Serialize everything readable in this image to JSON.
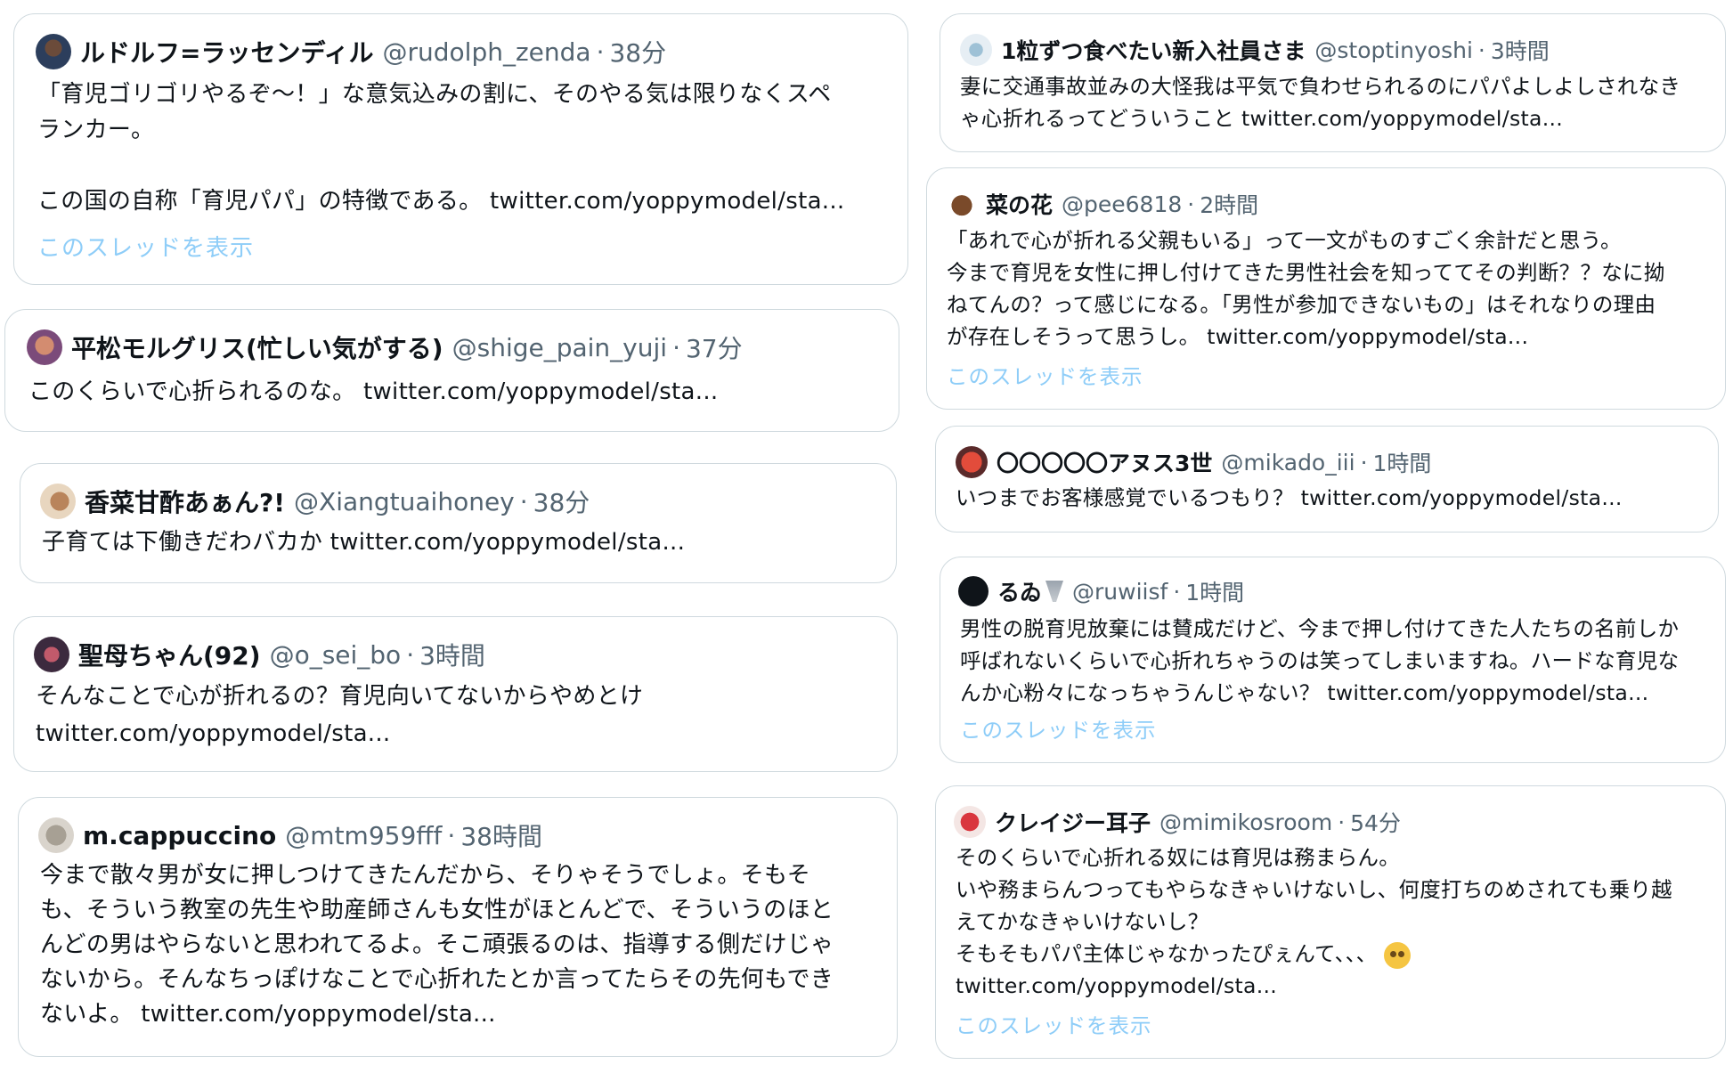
{
  "tweets": [
    {
      "name": "ルドルフ=ラッセンディル",
      "handle": "@rudolph_zenda",
      "time": "38分",
      "lines": [
        "「育児ゴリゴリやるぞ〜！」な意気込みの割に、そのやる気は限りなくスペ",
        "ランカー。",
        "",
        "この国の自称「育児パパ」の特徴である。 twitter.com/yoppymodel/sta..."
      ],
      "thread": "このスレッドを表示"
    },
    {
      "name": "平松モルグリス(忙しい気がする)",
      "handle": "@shige_pain_yuji",
      "time": "37分",
      "lines": [
        "このくらいで心折られるのな。 twitter.com/yoppymodel/sta..."
      ]
    },
    {
      "name": "香菜甘酢あぁん?!",
      "handle": "@Xiangtuaihoney",
      "time": "38分",
      "lines": [
        "子育ては下働きだわバカか twitter.com/yoppymodel/sta..."
      ]
    },
    {
      "name": "聖母ちゃん(92)",
      "handle": "@o_sei_bo",
      "time": "3時間",
      "lines": [
        "そんなことで心が折れるの？育児向いてないからやめとけ",
        "twitter.com/yoppymodel/sta..."
      ]
    },
    {
      "name": "m.cappuccino",
      "handle": "@mtm959fff",
      "time": "38時間",
      "lines": [
        "今まで散々男が女に押しつけてきたんだから、そりゃそうでしょ。そもそ",
        "も、そういう教室の先生や助産師さんも女性がほとんどで、そういうのほと",
        "んどの男はやらないと思われてるよ。そこ頑張るのは、指導する側だけじゃ",
        "ないから。そんなちっぽけなことで心折れたとか言ってたらその先何もでき",
        "ないよ。 twitter.com/yoppymodel/sta..."
      ]
    },
    {
      "name": "1粒ずつ食べたい新入社員さま",
      "handle": "@stoptinyoshi",
      "time": "3時間",
      "lines": [
        "妻に交通事故並みの大怪我は平気で負わせられるのにパパよしよしされなき",
        "ゃ心折れるってどういうこと twitter.com/yoppymodel/sta..."
      ]
    },
    {
      "name": "菜の花",
      "handle": "@pee6818",
      "time": "2時間",
      "lines": [
        "「あれで心が折れる父親もいる」って一文がものすごく余計だと思う。",
        "今まで育児を女性に押し付けてきた男性社会を知っててその判断？？なに拗",
        "ねてんの？って感じになる。「男性が参加できないもの」はそれなりの理由",
        "が存在しそうって思うし。 twitter.com/yoppymodel/sta..."
      ],
      "thread": "このスレッドを表示"
    },
    {
      "name": "〇〇〇〇〇アヌス3世",
      "handle": "@mikado_iii",
      "time": "1時間",
      "lines": [
        "いつまでお客様感覚でいるつもり？ twitter.com/yoppymodel/sta..."
      ]
    },
    {
      "name": "るゐ",
      "handle": "@ruwiisf",
      "time": "1時間",
      "lines": [
        "男性の脱育児放棄には賛成だけど、今まで押し付けてきた人たちの名前しか",
        "呼ばれないくらいで心折れちゃうのは笑ってしまいますね。ハードな育児な",
        "んか心粉々になっちゃうんじゃない？ twitter.com/yoppymodel/sta..."
      ],
      "thread": "このスレッドを表示"
    },
    {
      "name": "クレイジー耳子",
      "handle": "@mimikosroom",
      "time": "54分",
      "lines": [
        "そのくらいで心折れる奴には育児は務まらん。",
        "いや務まらんつってもやらなきゃいけないし、何度打ちのめされても乗り越",
        "えてかなきゃいけないし？",
        "そもそもパパ主体じゃなかったぴぇんて、、、",
        "twitter.com/yoppymodel/sta..."
      ],
      "thread": "このスレッドを表示"
    }
  ],
  "icons": {
    "avatars": [
      "avatar-icon"
    ],
    "emoji_line_icon": "pleading-face-emoji-icon",
    "name_emoji_icon": "tornado-emoji-icon"
  },
  "colors": {
    "border": "#cfd9de",
    "muted": "#536471",
    "thread_link": "#8ecdf8",
    "text": "#0f1419"
  }
}
